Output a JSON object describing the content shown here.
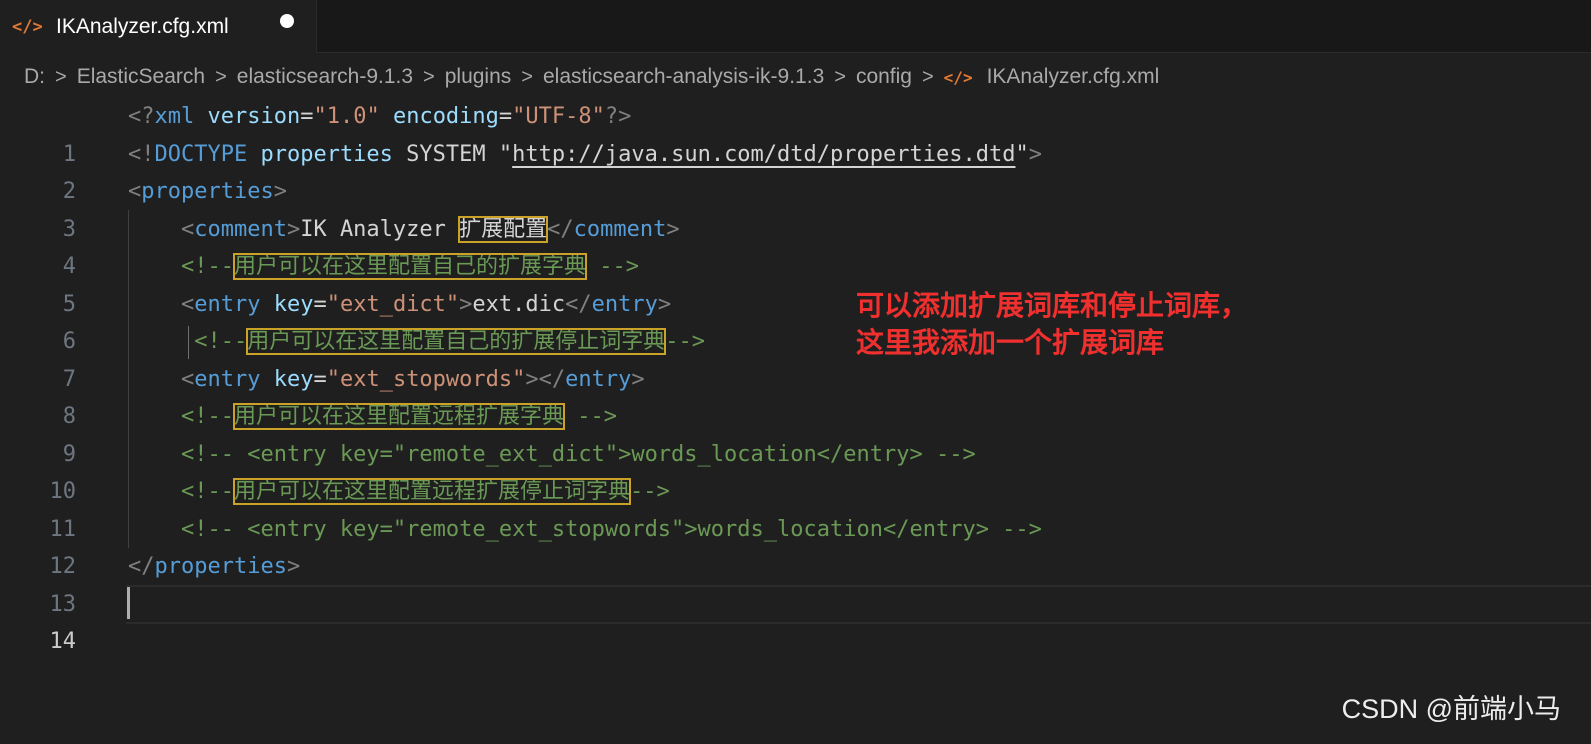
{
  "tab": {
    "icon": "xml-file-icon",
    "icon_glyph": "</>",
    "label": "IKAnalyzer.cfg.xml"
  },
  "breadcrumb": {
    "items": [
      "D:",
      "ElasticSearch",
      "elasticsearch-9.1.3",
      "plugins",
      "elasticsearch-analysis-ik-9.1.3",
      "config"
    ],
    "file_icon": "xml-file-icon",
    "file_icon_glyph": "</>",
    "file": "IKAnalyzer.cfg.xml",
    "separator": ">"
  },
  "editor": {
    "active_line": 14,
    "line_numbers": [
      "1",
      "2",
      "3",
      "4",
      "5",
      "6",
      "7",
      "8",
      "9",
      "10",
      "11",
      "12",
      "13",
      "14"
    ],
    "lines": {
      "l1": {
        "p1": "<?",
        "name": "xml",
        "sp1": " ",
        "attr1": "version",
        "eq1": "=",
        "val1": "\"1.0\"",
        "sp2": " ",
        "attr2": "encoding",
        "eq2": "=",
        "val2": "\"UTF-8\"",
        "p2": "?>"
      },
      "l2": {
        "p1": "<!",
        "name": "DOCTYPE",
        "sp1": " ",
        "attr1": "properties",
        "text": " SYSTEM \"",
        "url": "http://java.sun.com/dtd/properties.dtd",
        "q": "\"",
        "p2": ">"
      },
      "l3": {
        "p1": "<",
        "tag": "properties",
        "p2": ">"
      },
      "l4": {
        "indent": "    ",
        "p1": "<",
        "tag": "comment",
        "p2": ">",
        "text": "IK Analyzer ",
        "hl": "扩展配置",
        "p3": "</",
        "tag2": "comment",
        "p4": ">"
      },
      "l5": {
        "indent": "    ",
        "open": "<!--",
        "hl": "用户可以在这里配置自己的扩展字典",
        "close": " -->"
      },
      "l6": {
        "indent": "    ",
        "p1": "<",
        "tag": "entry",
        "sp": " ",
        "attr": "key",
        "eq": "=",
        "val": "\"ext_dict\"",
        "p2": ">",
        "text": "ext.dic",
        "p3": "</",
        "tag2": "entry",
        "p4": ">"
      },
      "l7": {
        "indent": "     ",
        "open": "<!--",
        "hl": "用户可以在这里配置自己的扩展停止词字典",
        "close": "-->"
      },
      "l8": {
        "indent": "    ",
        "p1": "<",
        "tag": "entry",
        "sp": " ",
        "attr": "key",
        "eq": "=",
        "val": "\"ext_stopwords\"",
        "p2": ">",
        "p3": "</",
        "tag2": "entry",
        "p4": ">"
      },
      "l9": {
        "indent": "    ",
        "open": "<!--",
        "hl": "用户可以在这里配置远程扩展字典",
        "close": " -->"
      },
      "l10": {
        "indent": "    ",
        "comment": "<!-- <entry key=\"remote_ext_dict\">words_location</entry> -->"
      },
      "l11": {
        "indent": "    ",
        "open": "<!--",
        "hl": "用户可以在这里配置远程扩展停止词字典",
        "close": "-->"
      },
      "l12": {
        "indent": "    ",
        "comment": "<!-- <entry key=\"remote_ext_stopwords\">words_location</entry> -->"
      },
      "l13": {
        "p1": "</",
        "tag": "properties",
        "p2": ">"
      }
    }
  },
  "annotation": {
    "line1": "可以添加扩展词库和停止词库，",
    "line2": "这里我添加一个扩展词库",
    "color": "#f0302f"
  },
  "watermark": "CSDN @前端小马",
  "colors": {
    "tag": "#569cd6",
    "attr": "#9cdcfe",
    "string": "#ce9178",
    "comment": "#6a9955",
    "highlight_border": "#c9a227",
    "background": "#1f1f1f"
  }
}
